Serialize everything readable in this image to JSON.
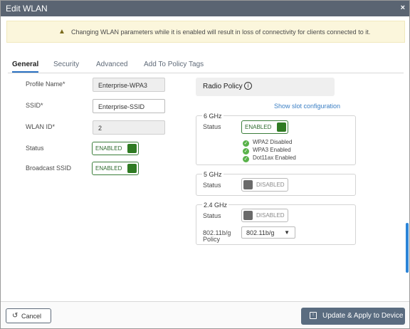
{
  "dialog": {
    "title": "Edit WLAN",
    "close_glyph": "×"
  },
  "warning": {
    "icon": "warning-triangle-icon",
    "text": "Changing WLAN parameters while it is enabled will result in loss of connectivity for clients connected to it."
  },
  "tabs": [
    {
      "label": "General",
      "active": true
    },
    {
      "label": "Security",
      "active": false
    },
    {
      "label": "Advanced",
      "active": false
    },
    {
      "label": "Add To Policy Tags",
      "active": false
    }
  ],
  "general": {
    "profile_name": {
      "label": "Profile Name*",
      "value": "Enterprise-WPA3"
    },
    "ssid": {
      "label": "SSID*",
      "value": "Enterprise-SSID"
    },
    "wlan_id": {
      "label": "WLAN ID*",
      "value": "2"
    },
    "status": {
      "label": "Status",
      "state": "ENABLED"
    },
    "broadcast_ssid": {
      "label": "Broadcast SSID",
      "state": "ENABLED"
    }
  },
  "radio_policy": {
    "title": "Radio Policy",
    "show_slot_link": "Show slot configuration",
    "band_6": {
      "title": "6 GHz",
      "status_label": "Status",
      "state": "ENABLED",
      "checks": [
        "WPA2 Disabled",
        "WPA3 Enabled",
        "Dot11ax Enabled"
      ]
    },
    "band_5": {
      "title": "5 GHz",
      "status_label": "Status",
      "state": "DISABLED"
    },
    "band_24": {
      "title": "2.4 GHz",
      "status_label": "Status",
      "state": "DISABLED",
      "policy_label_line1": "802.11b/g",
      "policy_label_line2": "Policy",
      "policy_value": "802.11b/g"
    }
  },
  "footer": {
    "cancel_label": "Cancel",
    "apply_label": "Update & Apply to Device"
  },
  "colors": {
    "titlebar": "#5a6472",
    "enabled_green": "#2f7b23",
    "link_blue": "#3b7fc4",
    "apply_button": "#5a6c80"
  }
}
